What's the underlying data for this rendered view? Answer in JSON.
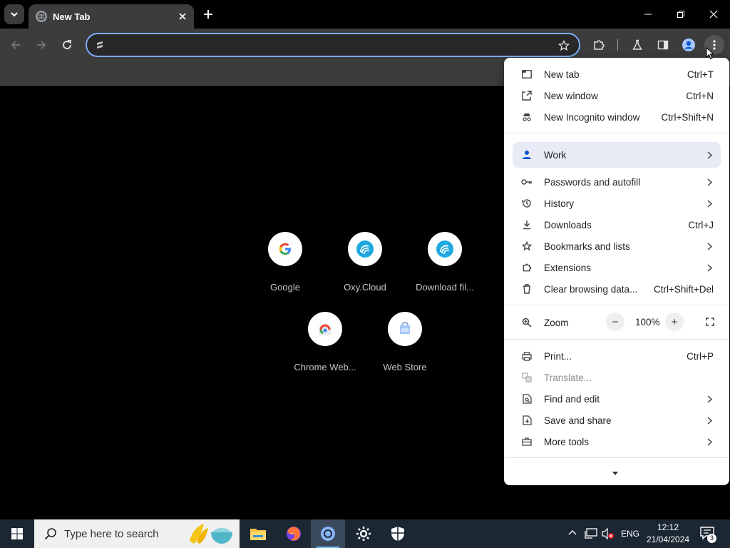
{
  "tab": {
    "title": "New Tab"
  },
  "omnibox": {
    "value": "",
    "placeholder": ""
  },
  "shortcuts": [
    {
      "label": "Google"
    },
    {
      "label": "Oxy.Cloud"
    },
    {
      "label": "Download fil..."
    },
    {
      "label": "Chrome Web..."
    },
    {
      "label": "Web Store"
    }
  ],
  "menu": {
    "new_tab": {
      "label": "New tab",
      "shortcut": "Ctrl+T"
    },
    "new_window": {
      "label": "New window",
      "shortcut": "Ctrl+N"
    },
    "new_incognito": {
      "label": "New Incognito window",
      "shortcut": "Ctrl+Shift+N"
    },
    "profile": {
      "label": "Work"
    },
    "passwords": {
      "label": "Passwords and autofill"
    },
    "history": {
      "label": "History"
    },
    "downloads": {
      "label": "Downloads",
      "shortcut": "Ctrl+J"
    },
    "bookmarks": {
      "label": "Bookmarks and lists"
    },
    "extensions": {
      "label": "Extensions"
    },
    "clear_data": {
      "label": "Clear browsing data...",
      "shortcut": "Ctrl+Shift+Del"
    },
    "zoom": {
      "label": "Zoom",
      "value": "100%",
      "minus": "−",
      "plus": "+"
    },
    "print": {
      "label": "Print...",
      "shortcut": "Ctrl+P"
    },
    "translate": {
      "label": "Translate..."
    },
    "find_edit": {
      "label": "Find and edit"
    },
    "save_share": {
      "label": "Save and share"
    },
    "more_tools": {
      "label": "More tools"
    }
  },
  "taskbar": {
    "search_placeholder": "Type here to search",
    "language": "ENG",
    "time": "12:12",
    "date": "21/04/2024",
    "notifications": "3"
  },
  "colors": {
    "accent": "#7cacf8",
    "toolbar_bg": "#3c3c3c",
    "menu_bg": "#ffffff",
    "taskbar_bg": "#1b2733"
  }
}
